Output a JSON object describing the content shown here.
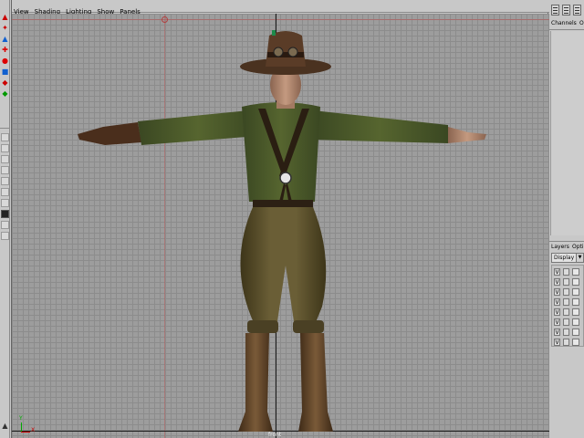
{
  "viewport": {
    "menu": [
      "View",
      "Shading",
      "Lighting",
      "Show",
      "Panels"
    ],
    "camera_label": "front"
  },
  "axis": {
    "x": "X",
    "y": "Y"
  },
  "right_panel": {
    "tabs": [
      "Channels",
      "O"
    ],
    "layers_tabs": [
      "Layers",
      "Opti"
    ],
    "display_value": "Display",
    "layer_rows": [
      "V",
      "V",
      "V",
      "V",
      "V",
      "V",
      "V",
      "V"
    ]
  },
  "colors": {
    "grid": "#9d9d9d",
    "coat": "#4b5a2e",
    "trousers": "#5e5230",
    "boots": "#6a4a2b",
    "hat": "#5a3c27"
  },
  "icons": {
    "tools": [
      "select-icon",
      "lasso-icon",
      "paint-icon",
      "move-icon",
      "rotate-icon",
      "scale-icon",
      "show-manipulator-icon"
    ]
  }
}
